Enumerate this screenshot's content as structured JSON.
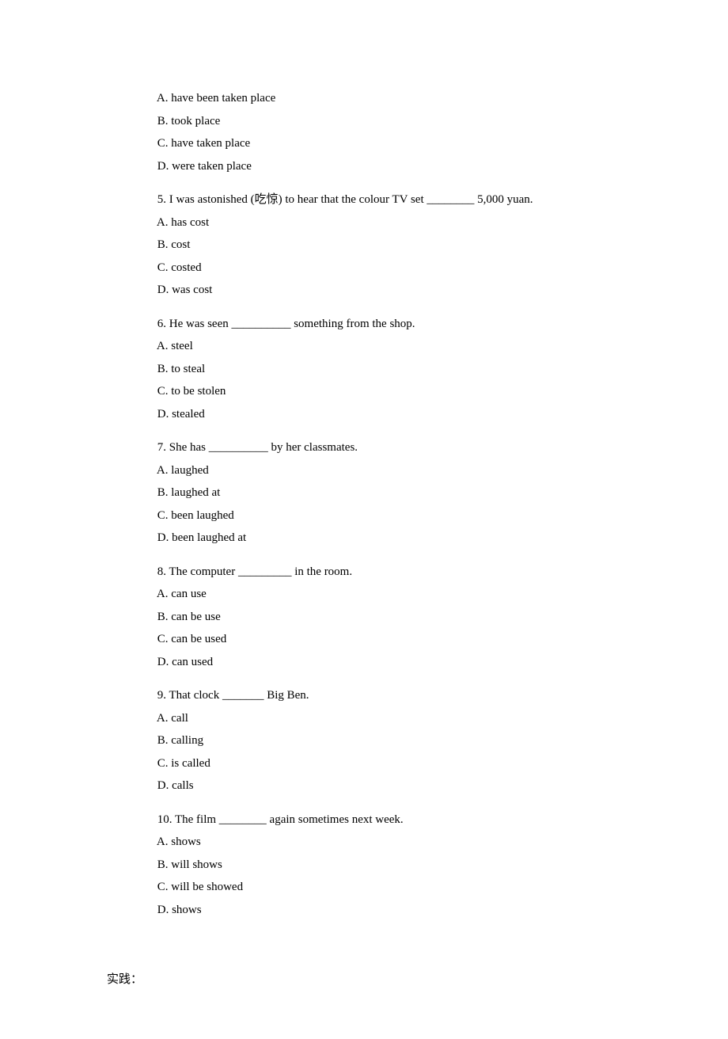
{
  "q4": {
    "opts": {
      "a": " A. have been taken place",
      "b": " B. took place",
      "c": " C. have taken place",
      "d": " D. were taken place"
    }
  },
  "q5": {
    "stem": " 5. I was astonished (吃惊) to hear that the colour TV set ________ 5,000 yuan.",
    "opts": {
      "a": " A. has cost",
      "b": " B. cost",
      "c": " C. costed",
      "d": " D. was cost"
    }
  },
  "q6": {
    "stem": " 6. He was seen __________ something from the shop.",
    "opts": {
      "a": " A. steel",
      "b": " B. to steal",
      "c": " C. to be stolen",
      "d": " D. stealed"
    }
  },
  "q7": {
    "stem": " 7. She has __________ by her classmates.",
    "opts": {
      "a": " A. laughed",
      "b": " B. laughed at",
      "c": " C. been laughed",
      "d": " D. been laughed at"
    }
  },
  "q8": {
    "stem": " 8. The computer _________ in the room.",
    "opts": {
      "a": " A. can use",
      "b": " B. can be use",
      "c": " C. can be used",
      "d": " D. can used"
    }
  },
  "q9": {
    "stem": " 9. That clock _______ Big Ben.",
    "opts": {
      "a": " A. call",
      "b": " B. calling",
      "c": " C. is called",
      "d": " D. calls"
    }
  },
  "q10": {
    "stem": " 10. The film ________ again sometimes next week.",
    "opts": {
      "a": " A. shows",
      "b": " B. will shows",
      "c": " C. will be showed",
      "d": " D. shows"
    }
  },
  "footer": "实践："
}
